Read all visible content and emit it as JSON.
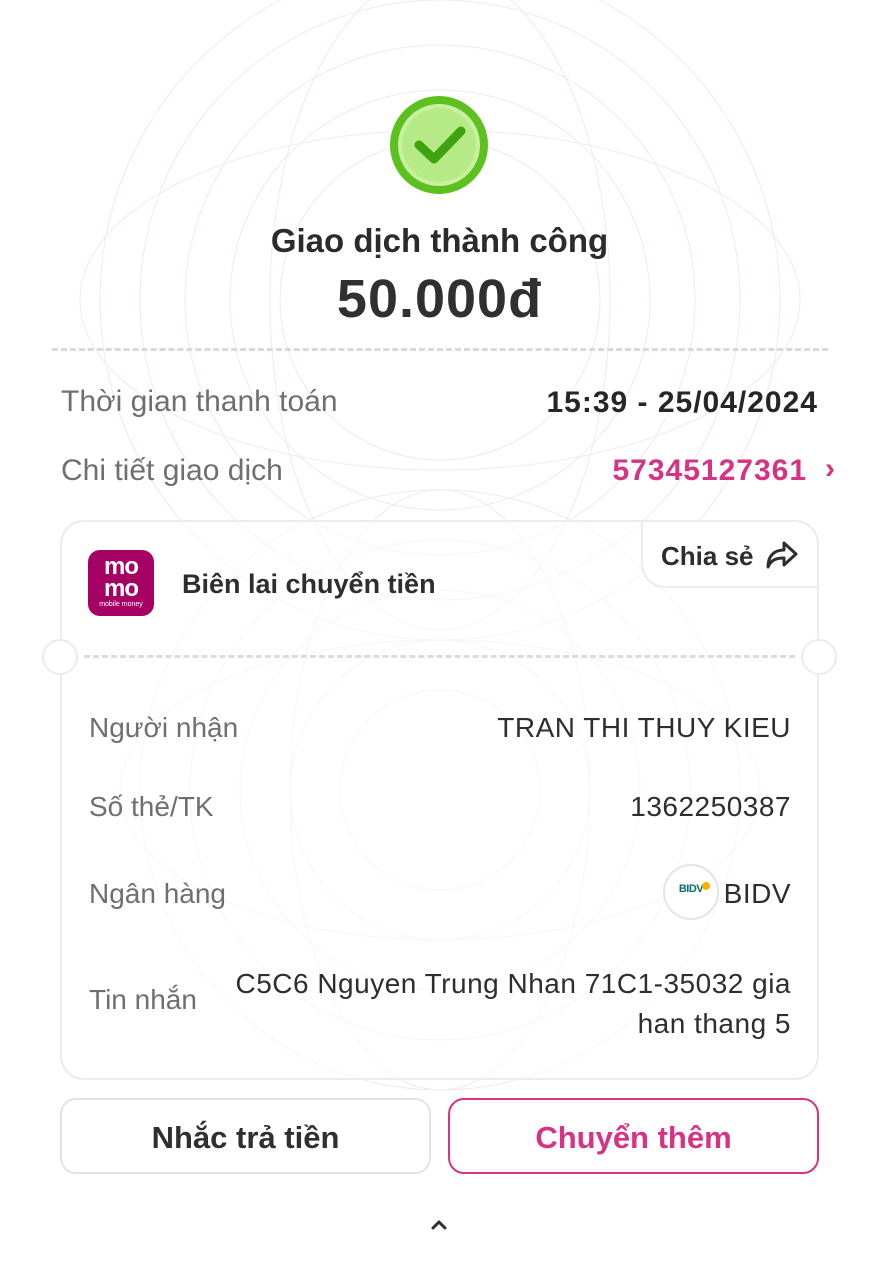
{
  "status": {
    "icon": "check-circle-icon",
    "title": "Giao dịch thành công",
    "amount": "50.000đ"
  },
  "summary": {
    "payment_time_label": "Thời gian thanh toán",
    "payment_time_value": "15:39 - 25/04/2024",
    "detail_label": "Chi tiết giao dịch",
    "detail_value": "57345127361",
    "detail_chevron": "›"
  },
  "receipt": {
    "logo_line1": "mo",
    "logo_line2": "mo",
    "logo_tagline": "mobile money",
    "title": "Biên lai chuyển tiền",
    "share_label": "Chia sẻ",
    "fields": {
      "recipient_label": "Người nhận",
      "recipient_value": "TRAN THI THUY KIEU",
      "account_label": "Số thẻ/TK",
      "account_value": "1362250387",
      "bank_label": "Ngân hàng",
      "bank_logo_text": "BIDV",
      "bank_value": "BIDV",
      "message_label": "Tin nhắn",
      "message_value": "C5C6 Nguyen Trung Nhan 71C1-35032 gia han thang 5"
    }
  },
  "actions": {
    "remind_label": "Nhắc trả tiền",
    "transfer_more_label": "Chuyển thêm"
  },
  "colors": {
    "accent": "#d63384",
    "success": "#5cc11f",
    "momo_brand": "#a50064"
  }
}
